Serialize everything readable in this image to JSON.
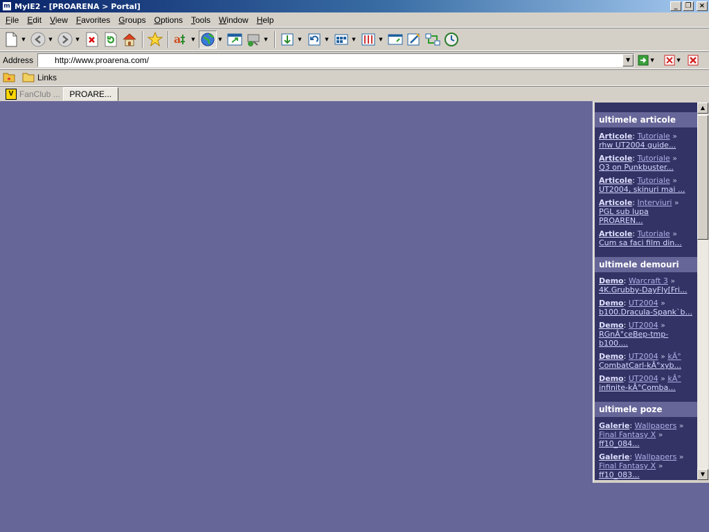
{
  "window": {
    "title": "MyIE2 - [PROARENA > Portal]"
  },
  "menu": [
    "File",
    "Edit",
    "View",
    "Favorites",
    "Groups",
    "Options",
    "Tools",
    "Window",
    "Help"
  ],
  "address": {
    "label": "Address",
    "url": "http://www.proarena.com/"
  },
  "links": {
    "label": "Links"
  },
  "tabs": [
    {
      "label": "FanClub ...",
      "active": false
    },
    {
      "label": "PROARE...",
      "active": true
    }
  ],
  "sidebar": {
    "sections": [
      {
        "title": "ultimele articole",
        "items": [
          {
            "cat": "Articole",
            "sub": "Tutoriale",
            "title": "rhw UT2004 guide..."
          },
          {
            "cat": "Articole",
            "sub": "Tutoriale",
            "title": "Q3 on Punkbuster..."
          },
          {
            "cat": "Articole",
            "sub": "Tutoriale",
            "title": "UT2004, skinuri mai ..."
          },
          {
            "cat": "Articole",
            "sub": "Interviuri",
            "title": "PGL sub lupa PROAREN..."
          },
          {
            "cat": "Articole",
            "sub": "Tutoriale",
            "title": "Cum sa faci film din..."
          }
        ]
      },
      {
        "title": "ultimele demouri",
        "items": [
          {
            "cat": "Demo",
            "sub": "Warcraft 3",
            "title": "4K.Grubby-DayFly[Fri..."
          },
          {
            "cat": "Demo",
            "sub": "UT2004",
            "title": "b100.Dracula-Spank`b..."
          },
          {
            "cat": "Demo",
            "sub": "UT2004",
            "title": "RGnÂ°ceBep-tmp-b100...."
          },
          {
            "cat": "Demo",
            "sub": "UT2004",
            "extra": "kÂ°",
            "title": "CombatCarl-kÂ°xyb..."
          },
          {
            "cat": "Demo",
            "sub": "UT2004",
            "extra": "kÂ°",
            "title": "infinite-kÂ°Comba..."
          }
        ]
      },
      {
        "title": "ultimele poze",
        "items": [
          {
            "cat": "Galerie",
            "sub": "Wallpapers",
            "sub2": "Final Fantasy X",
            "title": "ff10_084..."
          },
          {
            "cat": "Galerie",
            "sub": "Wallpapers",
            "sub2": "Final Fantasy X",
            "title": "ff10_083..."
          }
        ]
      }
    ]
  }
}
